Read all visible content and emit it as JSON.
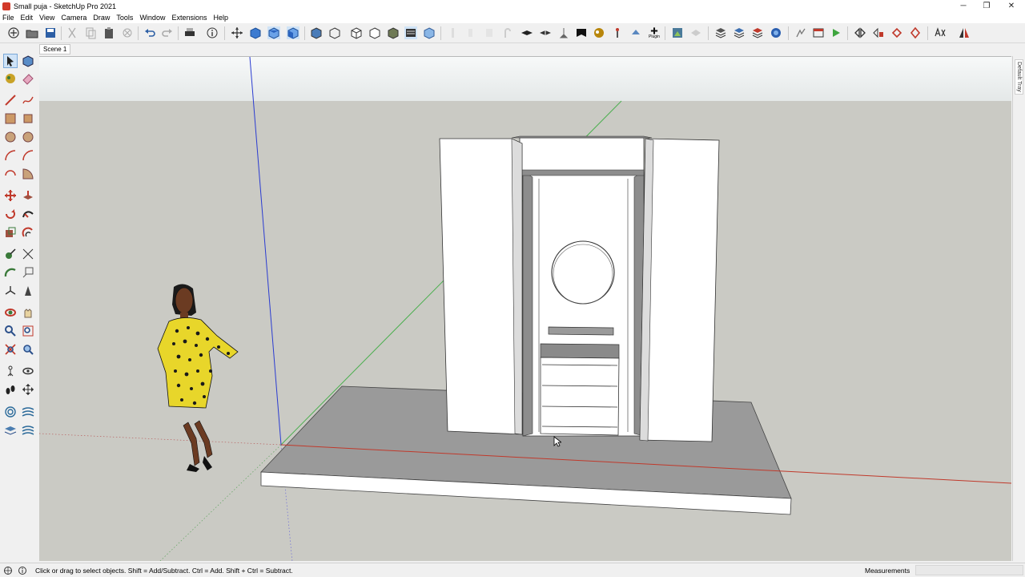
{
  "window": {
    "title": "Small puja - SketchUp Pro 2021",
    "minimize_glyph": "─",
    "restore_glyph": "❐",
    "close_glyph": "✕"
  },
  "menu": [
    "File",
    "Edit",
    "View",
    "Camera",
    "Draw",
    "Tools",
    "Window",
    "Extensions",
    "Help"
  ],
  "toolbar": {
    "plugin_label": "Plugin"
  },
  "scenes": {
    "tabs": [
      "Scene 1"
    ]
  },
  "tray": {
    "label": "Default Tray"
  },
  "status": {
    "hint": "Click or drag to select objects. Shift = Add/Subtract. Ctrl = Add. Shift + Ctrl = Subtract.",
    "measurements_label": "Measurements",
    "measurements_value": ""
  },
  "colors": {
    "sky": "#e9eded",
    "ground": "#cacac4",
    "platform_top": "#9a9a9a",
    "red_axis": "#c0392b",
    "green_axis": "#4caf50",
    "blue_axis": "#2b3cd1",
    "figure_dress": "#e8d62a"
  }
}
